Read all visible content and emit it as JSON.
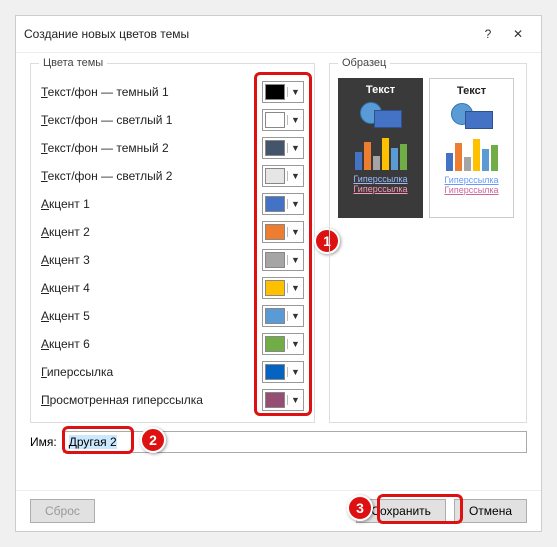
{
  "title": "Создание новых цветов темы",
  "group_theme": "Цвета темы",
  "group_sample": "Образец",
  "rows": [
    {
      "label": "Текст/фон — темный 1",
      "color": "#000000"
    },
    {
      "label": "Текст/фон — светлый 1",
      "color": "#ffffff"
    },
    {
      "label": "Текст/фон — темный 2",
      "color": "#44546a"
    },
    {
      "label": "Текст/фон — светлый 2",
      "color": "#e7e6e6"
    },
    {
      "label": "Акцент 1",
      "color": "#4472c4"
    },
    {
      "label": "Акцент 2",
      "color": "#ed7d31"
    },
    {
      "label": "Акцент 3",
      "color": "#a5a5a5"
    },
    {
      "label": "Акцент 4",
      "color": "#ffc000"
    },
    {
      "label": "Акцент 5",
      "color": "#5b9bd5"
    },
    {
      "label": "Акцент 6",
      "color": "#70ad47"
    },
    {
      "label": "Гиперссылка",
      "color": "#0563c1"
    },
    {
      "label": "Просмотренная гиперссылка",
      "color": "#954f72"
    }
  ],
  "sample_text": "Текст",
  "sample_link": "Гиперссылка",
  "sample_visited": "Гиперссылка",
  "name_label": "Имя:",
  "name_value": "Другая 2",
  "btn_reset": "Сброс",
  "btn_save": "Сохранить",
  "btn_cancel": "Отмена",
  "callouts": {
    "c1": "1",
    "c2": "2",
    "c3": "3"
  },
  "chart_bars": [
    {
      "h": 18,
      "c": "#4472c4"
    },
    {
      "h": 28,
      "c": "#ed7d31"
    },
    {
      "h": 14,
      "c": "#a5a5a5"
    },
    {
      "h": 32,
      "c": "#ffc000"
    },
    {
      "h": 22,
      "c": "#5b9bd5"
    },
    {
      "h": 26,
      "c": "#70ad47"
    }
  ]
}
